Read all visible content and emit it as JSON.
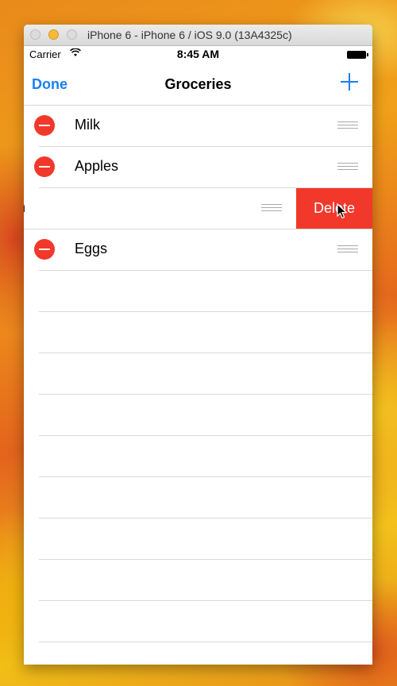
{
  "window": {
    "title": "iPhone 6 - iPhone 6 / iOS 9.0 (13A4325c)"
  },
  "status_bar": {
    "carrier": "Carrier",
    "time": "8:45 AM"
  },
  "nav": {
    "left_button": "Done",
    "title": "Groceries",
    "right_icon": "plus-icon"
  },
  "rows": [
    {
      "label": "Milk"
    },
    {
      "label": "Apples"
    },
    {
      "label": "n",
      "swiped": true,
      "action": "Delete"
    },
    {
      "label": "Eggs"
    }
  ],
  "colors": {
    "accent": "#1a7ff5",
    "delete": "#f2382b"
  }
}
